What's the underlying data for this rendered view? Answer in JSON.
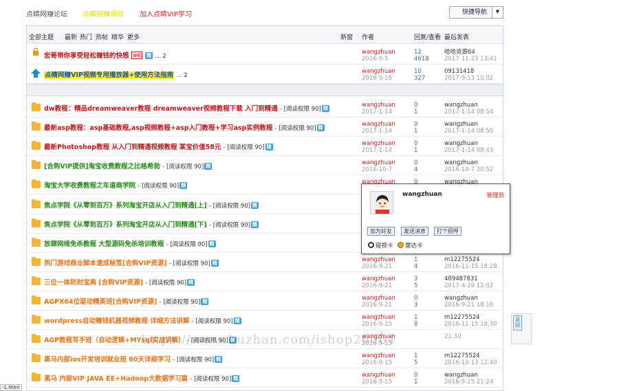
{
  "topbar": {
    "forum_name": "点睛网赚论坛",
    "link_project": "点睛网赚项目",
    "link_vip": "加入点睛VIP学习",
    "quick_nav": "快捷导航",
    "quick_nav_arrow": "▼"
  },
  "tabs": {
    "all": "全部主题",
    "latest": "最新",
    "hot": "热门",
    "hotpost": "热帖",
    "digest": "精华",
    "more": "更多"
  },
  "columns": {
    "new_window": "新窗",
    "author": "作者",
    "reply_view": "回复/查看",
    "last_post": "最后发表"
  },
  "sticky": [
    {
      "title": "宏哥带你享受轻松赚钱的快感",
      "edit_badge": "编辑",
      "badge": "精",
      "pages": "... 2",
      "author": "wangzhuan",
      "date": "2016-9-5",
      "replies": "12",
      "views": "4618",
      "last_user": "哈哈资源64",
      "last_time": "2017-11-23 13:41"
    },
    {
      "title": "点睛网赚VIP视频专用播放器+使用方法指南",
      "pages": "... 2",
      "author": "wangzhuan",
      "date": "2016-9-18",
      "replies": "10",
      "views": "327",
      "last_user": "09131418",
      "last_time": "2017-9-13 10:02"
    }
  ],
  "threads": [
    {
      "title": "dw教程：精品dreamweaver教程 dreamweaver视频教程下载 入门到精通",
      "perm": "- [阅读权限 90]",
      "badge": "精",
      "author": "wangzhuan",
      "date": "2017-1-14",
      "replies": "0",
      "views": "1",
      "last_user": "wangzhuan",
      "last_time": "2017-1-14 08:54"
    },
    {
      "title": "最新asp教程：asp基础教程,asp视频教程+asp入门教程+学习asp实例教程",
      "perm": "- [阅读权限 90]",
      "badge": "精",
      "author": "wangzhuan",
      "date": "2017-1-14",
      "replies": "0",
      "views": "1",
      "last_user": "wangzhuan",
      "last_time": "2017-1-14 08:50"
    },
    {
      "title": "最新Photoshop教程 从入门到精通视频教程 某宝价值58元",
      "perm": "- [阅读权限 90]",
      "badge": "精",
      "author": "wangzhuan",
      "date": "2017-1-14",
      "replies": "0",
      "views": "1",
      "last_user": "wangzhuan",
      "last_time": "2017-1-14 08:43"
    },
    {
      "title": "[合购VIP提供]淘宝收费教程之比格希勃",
      "perm": "- [阅读权限 90]",
      "badge": "精",
      "author": "wangzhuan",
      "date": "2016-10-7",
      "replies": "0",
      "views": "4",
      "last_user": "wangzhuan",
      "last_time": "2016-10-7 20:52"
    },
    {
      "title": "淘宝大学收费教程之车道商学院",
      "perm": "- [阅读权限 90]",
      "badge": "精",
      "author": "wangzhuan",
      "date": "",
      "replies": "0",
      "views": "",
      "last_user": "wangzhuan",
      "last_time": ""
    },
    {
      "title": "焦点学院《从零到百万》系列淘宝开店从入门到精通[上]",
      "perm": "- [阅读权限 90]",
      "badge": "精",
      "author": "",
      "date": "",
      "replies": "",
      "views": "",
      "last_user": "",
      "last_time": ""
    },
    {
      "title": "焦点学院《从零到百万》系列淘宝开店从入门到精通[下]",
      "perm": "- [阅读权限 90]",
      "badge": "精",
      "author": "",
      "date": "",
      "replies": "",
      "views": "",
      "last_user": "",
      "last_time": ""
    },
    {
      "title": "放肆网络免杀教程 大型源码免杀培训教程",
      "perm": "- [阅读权限 90]",
      "badge": "精",
      "author": "",
      "date": "",
      "replies": "",
      "views": "",
      "last_user": "",
      "last_time": ""
    },
    {
      "title": "热门游戏商业脚本速成秘笈[合购VIP资源]",
      "perm": "- [阅读权限 90]",
      "badge": "精",
      "author": "wangzhuan",
      "date": "2016-9-21",
      "replies": "1",
      "views": "4",
      "last_user": "m12275524",
      "last_time": "2016-11-15 18:28"
    },
    {
      "title": "三位一体防封宝典 [合购VIP资源]",
      "perm": "- [阅读权限 90]",
      "badge": "精",
      "author": "wangzhuan",
      "date": "2016-9-21",
      "replies": "3",
      "views": "5",
      "last_user": "409487831",
      "last_time": "2017-4-29 12:02"
    },
    {
      "title": "AGPX64位驱动精英班[合购VIP资源]",
      "perm": "- [阅读权限 90]",
      "badge": "精",
      "author": "wangzhuan",
      "date": "2016-9-21",
      "replies": "0",
      "views": "3",
      "last_user": "wangzhuan",
      "last_time": "2016-9-21 18:16"
    },
    {
      "title": "wordpress自动赚钱机器视频教程 详细方法讲解",
      "perm": "- [阅读权限 90]",
      "badge": "精",
      "author": "wangzhuan",
      "date": "2016-9-15",
      "replies": "1",
      "views": "8",
      "last_user": "m12275524",
      "last_time": "2016-11-15 18:30"
    },
    {
      "title": "AGP教程写手班（自动逻辑+MYsql实战讲解）",
      "perm": "- [阅读权限 90]",
      "badge": "精",
      "author": "wangzhuan",
      "date": "2016-9-15",
      "replies": "",
      "views": "",
      "last_user": "",
      "last_time": "21:30"
    },
    {
      "title": "黑马内部ios开发培训就业班 60天详细学习",
      "perm": "- [阅读权限 90]",
      "badge": "精",
      "author": "wangzhuan",
      "date": "2016-9-15",
      "replies": "1",
      "views": "5",
      "last_user": "m12275524",
      "last_time": "2016-10-13 12:40"
    },
    {
      "title": "黑马 内部VIP JAVA EE+Hadoop大数据学习篇",
      "perm": "- [阅读权限 90]",
      "badge": "精",
      "author": "wangzhuan",
      "date": "2016-9-15",
      "replies": "0",
      "views": "1",
      "last_user": "wangzhuan",
      "last_time": "2016-9-15 21:24"
    }
  ],
  "popup": {
    "username": "wangzhuan",
    "role": "管理员",
    "btn_friend": "加为好友",
    "btn_message": "发送消息",
    "btn_greet": "打个招呼",
    "mark1": "窥视卡",
    "mark2": "雷达卡"
  },
  "side": {
    "back": "返回"
  },
  "watermark": "https://www.huzhan.com/ishop26064",
  "status_url": "-1.html"
}
